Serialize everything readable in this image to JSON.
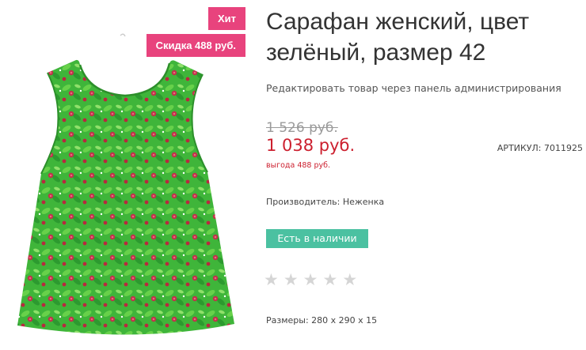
{
  "badges": {
    "hit": "Хит",
    "discount": "Скидка 488 руб."
  },
  "product": {
    "title": "Сарафан женский, цвет зелёный, размер 42",
    "admin_link": "Редактировать товар через панель администрирования",
    "old_price": "1 526 руб.",
    "new_price": "1 038 руб.",
    "benefit": "выгода 488 руб.",
    "article": "АРТИКУЛ: 7011925",
    "manufacturer": "Производитель: Неженка",
    "stock": "Есть в наличии",
    "sizes": "Размеры: 280 x 290 x 15"
  },
  "rating": {
    "value": 0,
    "max": 5
  },
  "colors": {
    "badge": "#e8437d",
    "price": "#cc1f2e",
    "stock": "#4bc1a1",
    "star_empty": "#d5d5d5",
    "dress_green": "#3fb53a"
  },
  "icons": {
    "rating_star": "star-icon"
  }
}
